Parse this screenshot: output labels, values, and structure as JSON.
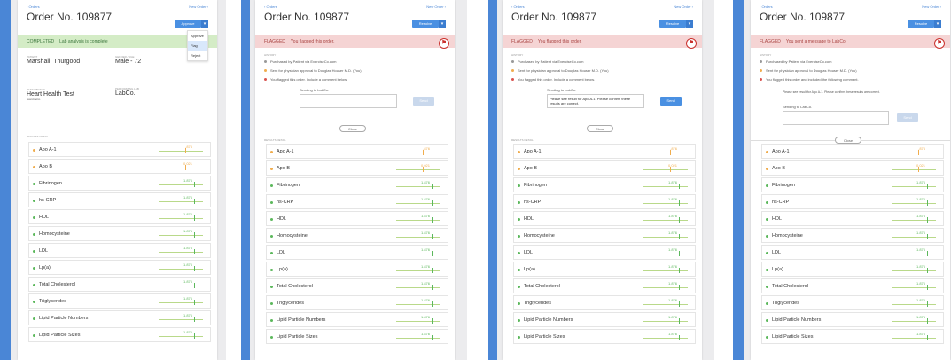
{
  "nav": {
    "back": "‹ Orders",
    "new_order": "New Order ›"
  },
  "order_title": "Order No. 109877",
  "action_button": "Approve",
  "resolve_button": "Resolve",
  "dropdown": [
    "Approve",
    "Flag",
    "Reject"
  ],
  "frames": [
    {
      "banner_tag": "COMPLETED",
      "banner_text": "Lab analysis is complete"
    },
    {
      "banner_tag": "FLAGGED",
      "banner_text": "You flagged this order."
    },
    {
      "banner_tag": "FLAGGED",
      "banner_text": "You flagged this order."
    },
    {
      "banner_tag": "FLAGGED",
      "banner_text": "You sent a message to LabCo."
    }
  ],
  "patient": {
    "patient_label": "PATIENT",
    "patient_name": "Marshall, Thurgood",
    "gender_label": "GENDER / AGE",
    "gender_age": "Male - 72",
    "panel_label": "PANEL BRAND",
    "panel_name": "Heart Health Test",
    "panel_sub": "ExerciseCo",
    "lab_label": "PERFORMING LAB",
    "lab_name": "LabCo."
  },
  "history": {
    "label": "HISTORY",
    "items": [
      "Purchased by Patient via ExerciseCo.com",
      "Sent for physician approval to Douglas Houser M.D. (You)",
      "You flagged this order. Include a comment below."
    ],
    "item3_sent": "You flagged this order and included the following comment."
  },
  "compose": {
    "label": "Sending to LabCo.",
    "message": "Please see result for Apo A-1. Please confirm these results are correct.",
    "send": "Send"
  },
  "close_label": "Close",
  "results_label": "RESULTS DETAIL",
  "results": [
    {
      "name": "Apo A-1",
      "value": ".876",
      "status": "warn"
    },
    {
      "name": "Apo B",
      "value": "0.021",
      "status": "warn"
    },
    {
      "name": "Fibrinogen",
      "value": "1.876",
      "status": "ok"
    },
    {
      "name": "hs-CRP",
      "value": "1.876",
      "status": "ok"
    },
    {
      "name": "HDL",
      "value": "1.876",
      "status": "ok"
    },
    {
      "name": "Homocysteine",
      "value": "1.876",
      "status": "ok"
    },
    {
      "name": "LDL",
      "value": "1.876",
      "status": "ok"
    },
    {
      "name": "Lp(a)",
      "value": "1.876",
      "status": "ok"
    },
    {
      "name": "Total Cholesterol",
      "value": "1.876",
      "status": "ok"
    },
    {
      "name": "Triglycerides",
      "value": "1.876",
      "status": "ok"
    },
    {
      "name": "Lipid Particle Numbers",
      "value": "1.876",
      "status": "ok"
    },
    {
      "name": "Lipid Particle Sizes",
      "value": "1.876",
      "status": "ok"
    }
  ],
  "colors": {
    "accent": "#4a86d6",
    "ok": "#5cb85c",
    "warn": "#f0ad4e",
    "flag": "#d9534f"
  }
}
